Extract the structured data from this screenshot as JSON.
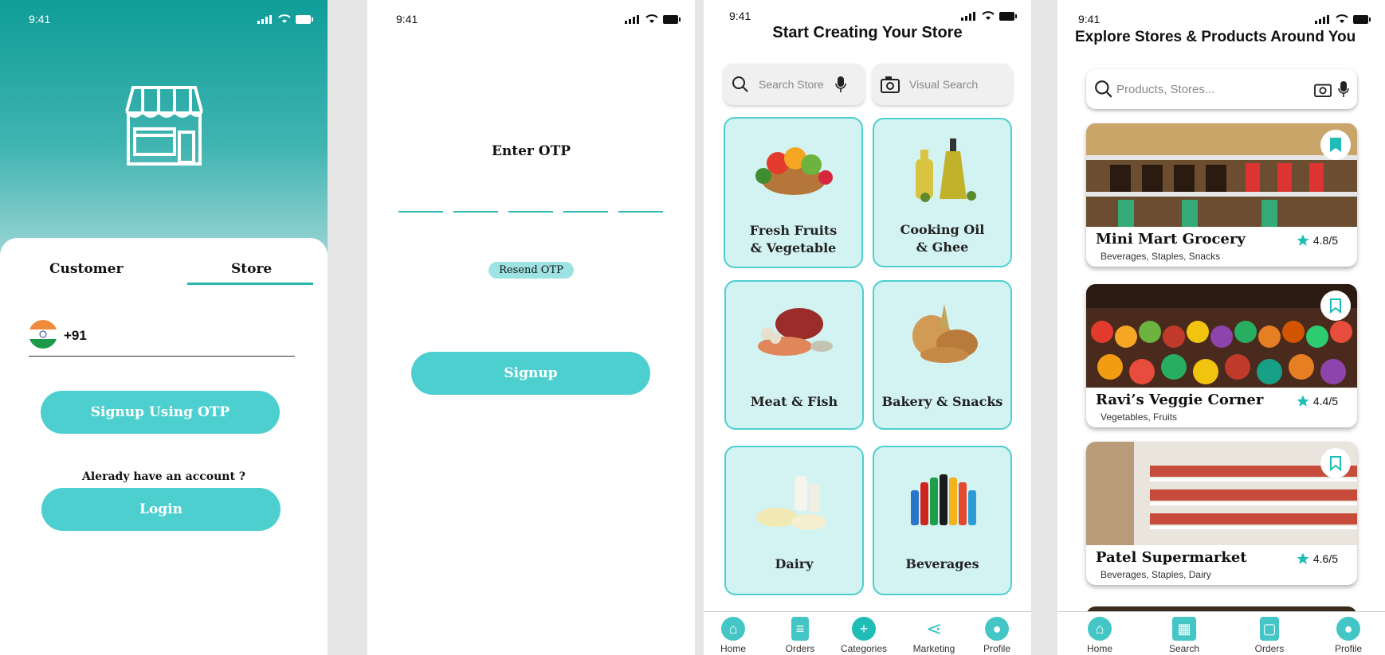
{
  "status": {
    "time": "9:41"
  },
  "screen1": {
    "tabs": [
      "Customer",
      "Store"
    ],
    "country_code": "+91",
    "signup_otp_label": "Signup Using OTP",
    "have_account_text": "Alerady have an account ?",
    "login_label": "Login"
  },
  "screen2": {
    "title": "Enter OTP",
    "resend_label": "Resend OTP",
    "signup_label": "Signup"
  },
  "screen3": {
    "title": "Start Creating Your Store",
    "search_placeholder": "Search Store",
    "visual_search_label": "Visual Search",
    "categories": [
      {
        "line1": "Fresh Fruits",
        "line2": "& Vegetable"
      },
      {
        "line1": "Cooking Oil",
        "line2": "& Ghee"
      },
      {
        "line1": "Meat & Fish",
        "line2": ""
      },
      {
        "line1": "Bakery & Snacks",
        "line2": ""
      },
      {
        "line1": "Dairy",
        "line2": ""
      },
      {
        "line1": "Beverages",
        "line2": ""
      }
    ],
    "nav": [
      "Home",
      "Orders",
      "Categories",
      "Marketing",
      "Profile"
    ]
  },
  "screen4": {
    "title": "Explore Stores & Products Around You",
    "search_placeholder": "Products, Stores...",
    "stores": [
      {
        "name": "Mini Mart Grocery",
        "tags": "Beverages, Staples, Snacks",
        "rating": "4.8/5"
      },
      {
        "name": "Ravi’s Veggie Corner",
        "tags": "Vegetables, Fruits",
        "rating": "4.4/5"
      },
      {
        "name": "Patel Supermarket",
        "tags": "Beverages, Staples, Dairy",
        "rating": "4.6/5"
      }
    ],
    "nav": [
      "Home",
      "Search",
      "Orders",
      "Profile"
    ]
  },
  "colors": {
    "accent": "#4ecfcf",
    "teal_dark": "#0f9d98",
    "tile_bg": "#d3f2f2"
  }
}
